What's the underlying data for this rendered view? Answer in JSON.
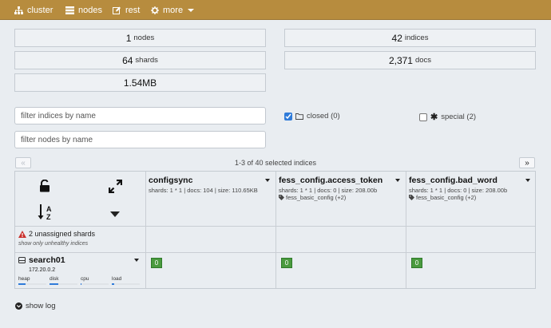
{
  "nav": [
    {
      "label": "cluster",
      "icon": "sitemap-icon"
    },
    {
      "label": "nodes",
      "icon": "server-icon"
    },
    {
      "label": "rest",
      "icon": "edit-icon"
    },
    {
      "label": "more",
      "icon": "gear-icon"
    }
  ],
  "stats": {
    "nodes": {
      "num": "1",
      "unit": "nodes"
    },
    "indices": {
      "num": "42",
      "unit": "indices"
    },
    "shards": {
      "num": "64",
      "unit": "shards"
    },
    "docs": {
      "num": "2,371",
      "unit": "docs"
    },
    "size": {
      "num": "1.54MB"
    }
  },
  "filters": {
    "indices_placeholder": "filter indices by name",
    "nodes_placeholder": "filter nodes by name",
    "closed_label": "closed (0)",
    "closed_checked": true,
    "special_label": "special (2)",
    "special_checked": false
  },
  "pager": {
    "prev": "«",
    "next": "»",
    "text": "1-3 of 40 selected indices"
  },
  "indices": [
    {
      "name": "configsync",
      "meta": "shards: 1 * 1 | docs: 104 | size: 110.65KB",
      "alias": ""
    },
    {
      "name": "fess_config.access_token",
      "meta": "shards: 1 * 1 | docs: 0 | size: 208.00b",
      "alias": "fess_basic_config (+2)"
    },
    {
      "name": "fess_config.bad_word",
      "meta": "shards: 1 * 1 | docs: 0 | size: 208.00b",
      "alias": "fess_basic_config (+2)"
    }
  ],
  "unassigned": {
    "label": "2 unassigned shards",
    "link": "show only unhealthy indices"
  },
  "node": {
    "name": "search01",
    "ip": "172.20.0.2",
    "metrics": [
      {
        "label": "heap",
        "value": 0.25
      },
      {
        "label": "disk",
        "value": 0.3
      },
      {
        "label": "cpu",
        "value": 0.02
      },
      {
        "label": "load",
        "value": 0.08
      }
    ],
    "shard_label": "0"
  },
  "footer": {
    "show_log": "show log"
  },
  "colors": {
    "topbar": "#b78c3e",
    "shard": "#4a9a3f",
    "accent": "#2f7bd9",
    "warning": "#c9302c"
  }
}
